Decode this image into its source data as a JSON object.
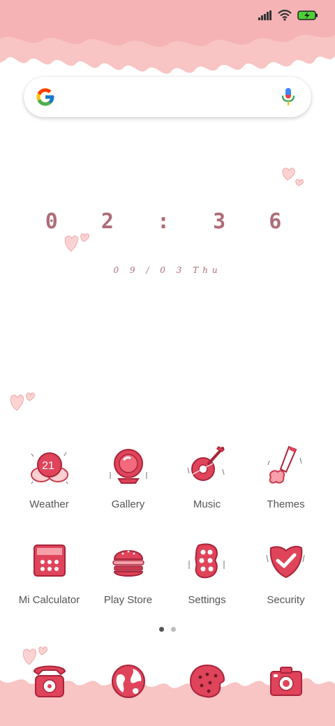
{
  "status_bar": {
    "signal_icon": "signal-bars-icon",
    "wifi_icon": "wifi-icon",
    "battery_icon": "battery-charging-icon"
  },
  "search": {
    "logo_icon": "google-logo-icon",
    "mic_icon": "microphone-icon",
    "placeholder": ""
  },
  "clock": {
    "time": "0 2 : 3 6",
    "date": "0 9 / 0 3  Thu"
  },
  "weather_badge": "21",
  "apps_row1": [
    {
      "label": "Weather",
      "icon": "weather-icon"
    },
    {
      "label": "Gallery",
      "icon": "gallery-icon"
    },
    {
      "label": "Music",
      "icon": "music-icon"
    },
    {
      "label": "Themes",
      "icon": "themes-icon"
    }
  ],
  "apps_row2": [
    {
      "label": "Mi Calculator",
      "icon": "calculator-icon"
    },
    {
      "label": "Play Store",
      "icon": "play-store-icon"
    },
    {
      "label": "Settings",
      "icon": "settings-icon"
    },
    {
      "label": "Security",
      "icon": "security-icon"
    }
  ],
  "pages": {
    "count": 2,
    "active": 1
  },
  "dock": [
    {
      "icon": "phone-icon"
    },
    {
      "icon": "browser-icon"
    },
    {
      "icon": "messages-icon"
    },
    {
      "icon": "camera-icon"
    }
  ],
  "colors": {
    "accent": "#e0445a",
    "accent_light": "#f7c3c6",
    "clock_text": "#b06b78",
    "label_text": "#555555"
  }
}
